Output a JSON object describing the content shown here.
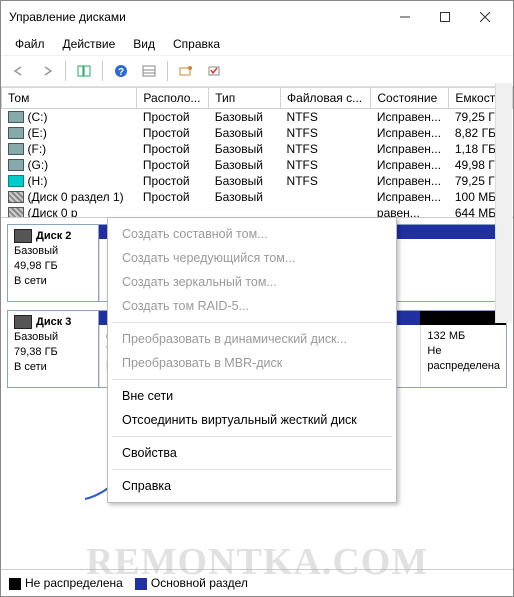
{
  "title": "Управление дисками",
  "menu": [
    "Файл",
    "Действие",
    "Вид",
    "Справка"
  ],
  "columns": [
    "Том",
    "Располо...",
    "Тип",
    "Файловая с...",
    "Состояние",
    "Емкость"
  ],
  "volumes": [
    {
      "name": "(C:)",
      "layout": "Простой",
      "type": "Базовый",
      "fs": "NTFS",
      "status": "Исправен...",
      "cap": "79,25 ГБ",
      "icon": "std"
    },
    {
      "name": "(E:)",
      "layout": "Простой",
      "type": "Базовый",
      "fs": "NTFS",
      "status": "Исправен...",
      "cap": "8,82 ГБ",
      "icon": "std"
    },
    {
      "name": "(F:)",
      "layout": "Простой",
      "type": "Базовый",
      "fs": "NTFS",
      "status": "Исправен...",
      "cap": "1,18 ГБ",
      "icon": "std"
    },
    {
      "name": "(G:)",
      "layout": "Простой",
      "type": "Базовый",
      "fs": "NTFS",
      "status": "Исправен...",
      "cap": "49,98 ГБ",
      "icon": "std"
    },
    {
      "name": "(H:)",
      "layout": "Простой",
      "type": "Базовый",
      "fs": "NTFS",
      "status": "Исправен...",
      "cap": "79,25 ГБ",
      "icon": "teal"
    },
    {
      "name": "(Диск 0 раздел 1)",
      "layout": "Простой",
      "type": "Базовый",
      "fs": "",
      "status": "Исправен...",
      "cap": "100 МБ",
      "icon": "stripe"
    },
    {
      "name": "(Диск 0 р",
      "layout": "",
      "type": "",
      "fs": "",
      "status": "   равен...",
      "cap": "644 МБ",
      "icon": "stripe"
    }
  ],
  "ctx": {
    "g1": [
      "Создать составной том...",
      "Создать чередующийся том...",
      "Создать зеркальный том...",
      "Создать том RAID-5..."
    ],
    "g2": [
      "Преобразовать в динамический диск...",
      "Преобразовать в MBR-диск"
    ],
    "g3": [
      "Вне сети",
      "Отсоединить виртуальный жесткий диск"
    ],
    "g4": [
      "Свойства"
    ],
    "g5": [
      "Справка"
    ]
  },
  "disks": [
    {
      "name": "Диск 2",
      "type": "Базовый",
      "size": "49,98 ГБ",
      "status": "В сети",
      "parts": [
        {
          "head": "blue",
          "lines": []
        }
      ]
    },
    {
      "name": "Диск 3",
      "type": "Базовый",
      "size": "79,38 ГБ",
      "status": "В сети",
      "parts": [
        {
          "head": "blue",
          "lines": [
            "(H:)",
            "79,25 ГБ NTFS",
            "Исправен (Базовый раздел диска)"
          ],
          "flex": 4
        },
        {
          "head": "black",
          "lines": [
            "",
            "132 МБ",
            "Не распределена"
          ],
          "flex": 1
        }
      ]
    }
  ],
  "legend": [
    {
      "cls": "black",
      "label": "Не распределена"
    },
    {
      "cls": "blue",
      "label": "Основной раздел"
    }
  ],
  "watermark": "REMONTKA.COM"
}
